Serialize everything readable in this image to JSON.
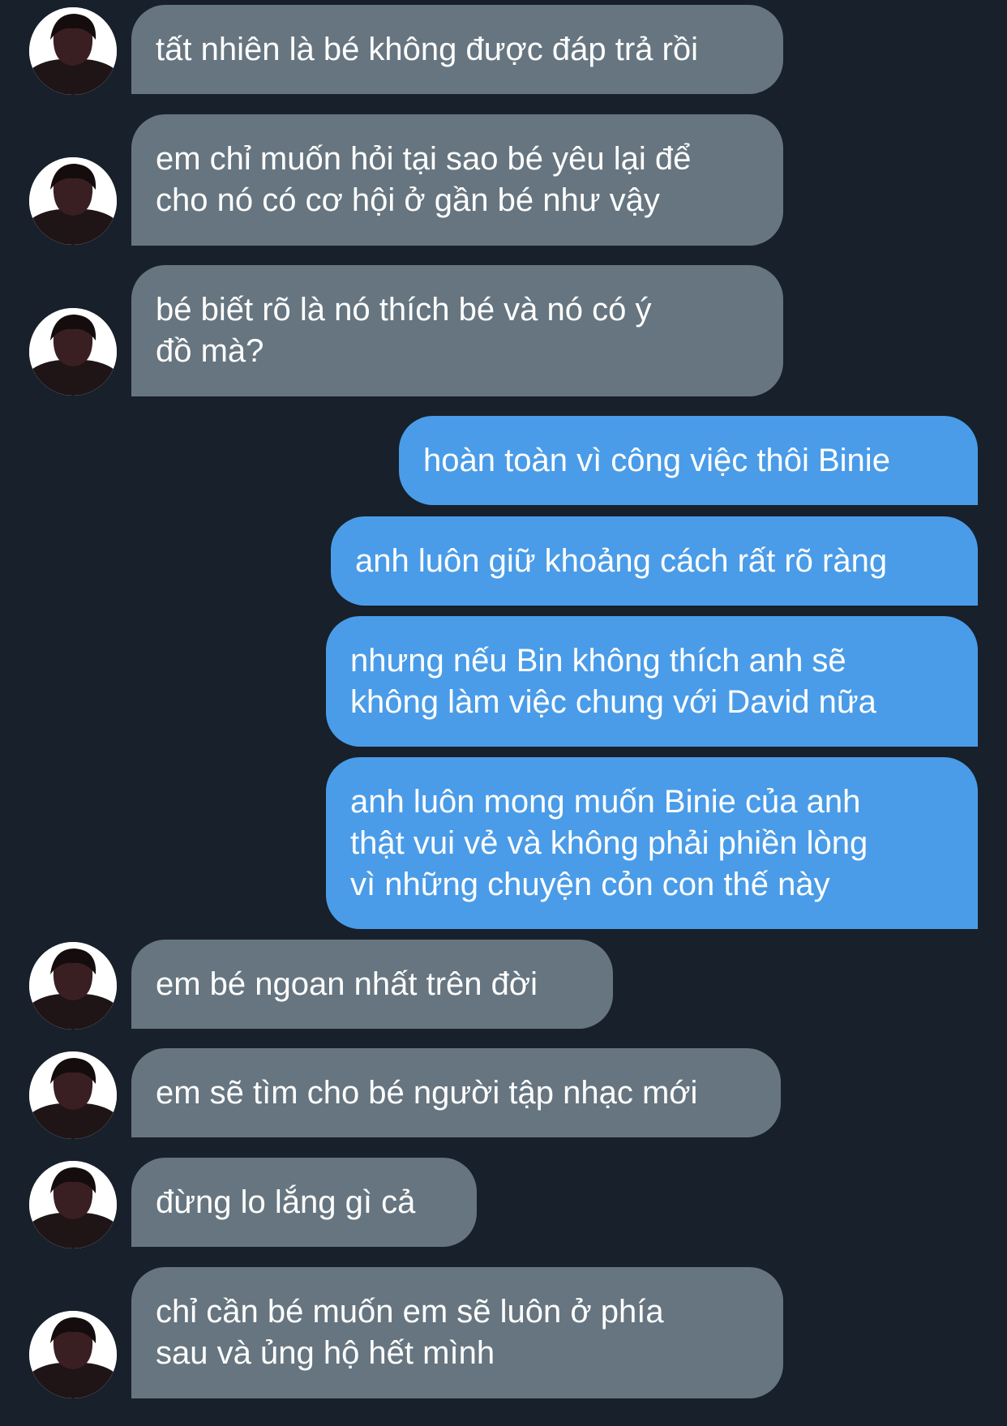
{
  "conversation": {
    "messages": [
      {
        "side": "in",
        "text": "tất nhiên là bé không được đáp trả rồi"
      },
      {
        "side": "in",
        "text": "em chỉ muốn hỏi tại sao bé yêu lại để\ncho nó có cơ hội ở gần bé như vậy"
      },
      {
        "side": "in",
        "text": "bé biết rõ là nó thích bé và nó có ý\nđồ mà?"
      },
      {
        "side": "out",
        "text": "hoàn toàn vì công việc thôi Binie"
      },
      {
        "side": "out",
        "text": "anh luôn giữ khoảng cách rất rõ ràng"
      },
      {
        "side": "out",
        "text": "nhưng nếu Bin không thích anh sẽ\nkhông làm việc chung với David nữa"
      },
      {
        "side": "out",
        "text": "anh luôn mong muốn Binie của anh\nthật vui vẻ và không phải phiền lòng\nvì những chuyện cỏn con thế này"
      },
      {
        "side": "in",
        "text": "em bé ngoan nhất trên đời"
      },
      {
        "side": "in",
        "text": "em sẽ tìm cho bé người tập nhạc mới"
      },
      {
        "side": "in",
        "text": "đừng lo lắng gì cả"
      },
      {
        "side": "in",
        "text": "chỉ cần bé muốn em sẽ luôn ở phía\nsau và ủng hộ hết mình"
      }
    ]
  },
  "colors": {
    "background": "#17202b",
    "incoming_bubble": "#66757f",
    "outgoing_bubble": "#4a9ce8",
    "text": "#ffffff"
  },
  "icons": {
    "avatar": "avatar-icon"
  }
}
